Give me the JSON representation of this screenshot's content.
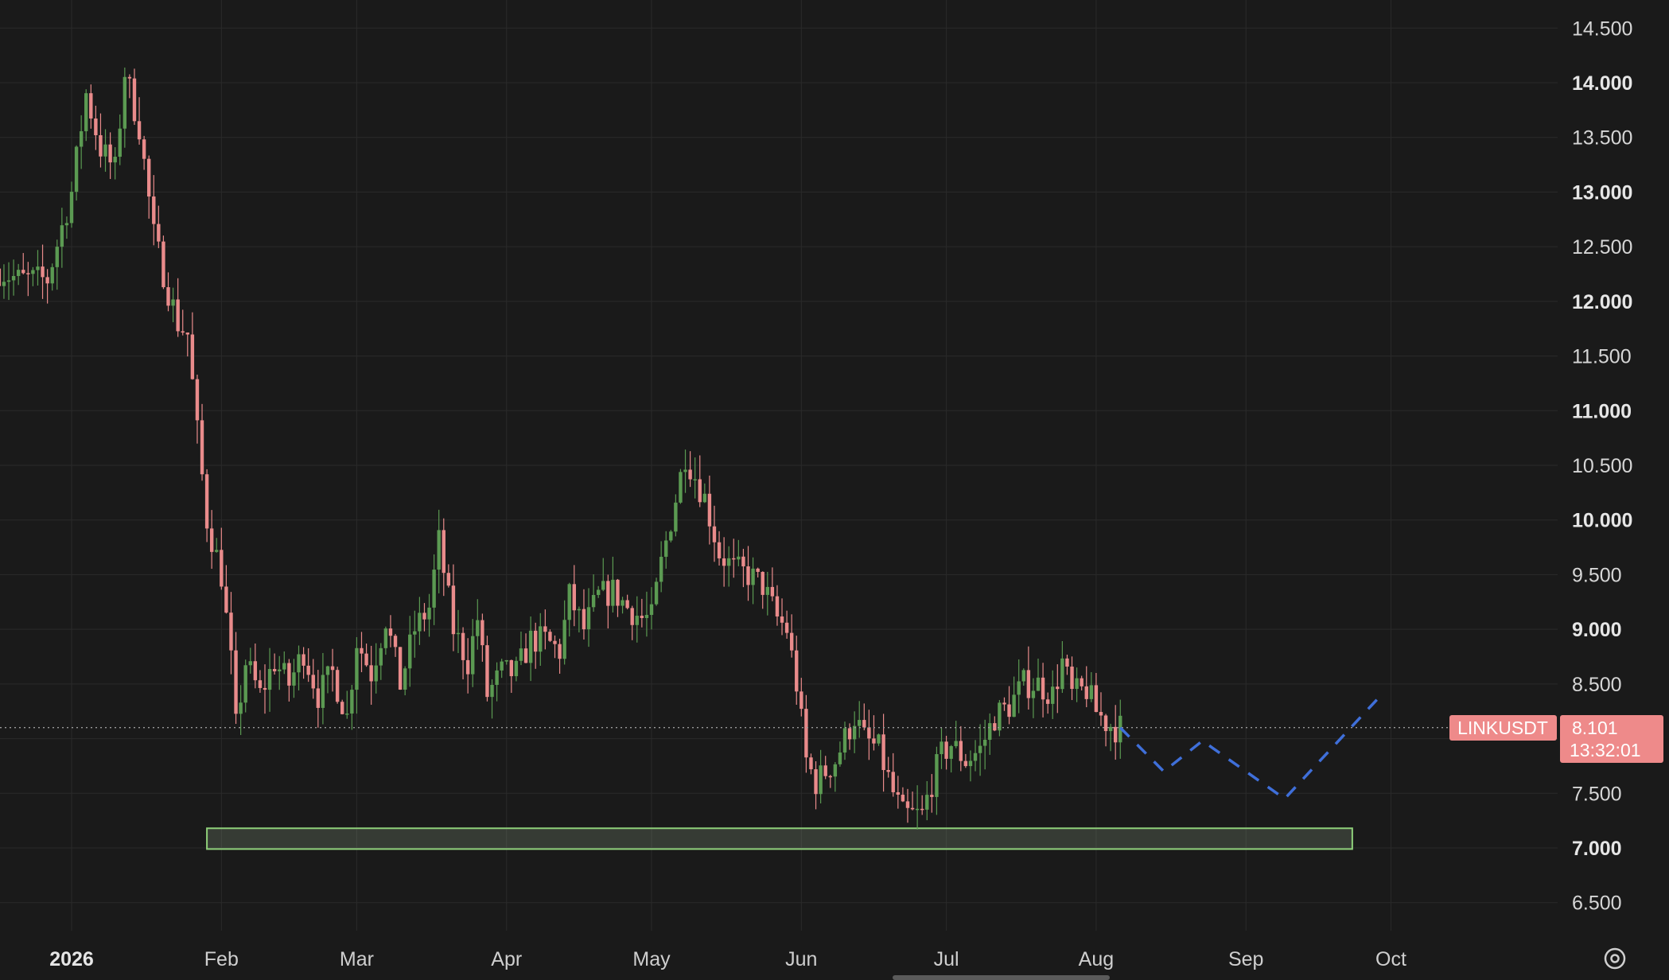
{
  "chart_data": {
    "type": "candlestick",
    "symbol": "LINKUSDT",
    "last_price": "8.101",
    "countdown": "13:32:01",
    "y_ticks": [
      {
        "value": 14.5,
        "label": "14.500",
        "major": false
      },
      {
        "value": 14.0,
        "label": "14.000",
        "major": true
      },
      {
        "value": 13.5,
        "label": "13.500",
        "major": false
      },
      {
        "value": 13.0,
        "label": "13.000",
        "major": true
      },
      {
        "value": 12.5,
        "label": "12.500",
        "major": false
      },
      {
        "value": 12.0,
        "label": "12.000",
        "major": true
      },
      {
        "value": 11.5,
        "label": "11.500",
        "major": false
      },
      {
        "value": 11.0,
        "label": "11.000",
        "major": true
      },
      {
        "value": 10.5,
        "label": "10.500",
        "major": false
      },
      {
        "value": 10.0,
        "label": "10.000",
        "major": true
      },
      {
        "value": 9.5,
        "label": "9.500",
        "major": false
      },
      {
        "value": 9.0,
        "label": "9.000",
        "major": true
      },
      {
        "value": 8.5,
        "label": "8.500",
        "major": false
      },
      {
        "value": 7.5,
        "label": "7.500",
        "major": false
      },
      {
        "value": 7.0,
        "label": "7.000",
        "major": true
      },
      {
        "value": 6.5,
        "label": "6.500",
        "major": false
      }
    ],
    "x_ticks": [
      {
        "date": "2026-01-01",
        "label": "2026",
        "major": true
      },
      {
        "date": "2026-02-01",
        "label": "Feb",
        "major": false
      },
      {
        "date": "2026-03-01",
        "label": "Mar",
        "major": false
      },
      {
        "date": "2026-04-01",
        "label": "Apr",
        "major": false
      },
      {
        "date": "2026-05-01",
        "label": "May",
        "major": false
      },
      {
        "date": "2026-06-01",
        "label": "Jun",
        "major": false
      },
      {
        "date": "2026-07-01",
        "label": "Jul",
        "major": false
      },
      {
        "date": "2026-08-01",
        "label": "Aug",
        "major": false
      },
      {
        "date": "2026-09-01",
        "label": "Sep",
        "major": false
      },
      {
        "date": "2026-10-01",
        "label": "Oct",
        "major": false
      }
    ],
    "x_range": [
      "2025-12-17",
      "2026-10-16"
    ],
    "y_range": [
      6.2,
      14.75
    ],
    "price_path_keypoints": [
      [
        "2025-12-17",
        12.3
      ],
      [
        "2025-12-22",
        12.2
      ],
      [
        "2025-12-28",
        12.2
      ],
      [
        "2026-01-02",
        13.0
      ],
      [
        "2026-01-05",
        13.9
      ],
      [
        "2026-01-08",
        13.4
      ],
      [
        "2026-01-11",
        13.2
      ],
      [
        "2026-01-13",
        14.1
      ],
      [
        "2026-01-16",
        13.6
      ],
      [
        "2026-01-19",
        12.6
      ],
      [
        "2026-01-22",
        12.1
      ],
      [
        "2026-01-24",
        11.8
      ],
      [
        "2026-01-26",
        11.7
      ],
      [
        "2026-01-28",
        10.8
      ],
      [
        "2026-01-30",
        10.0
      ],
      [
        "2026-02-02",
        9.5
      ],
      [
        "2026-02-04",
        8.7
      ],
      [
        "2026-02-05",
        8.1
      ],
      [
        "2026-02-07",
        8.7
      ],
      [
        "2026-02-10",
        8.4
      ],
      [
        "2026-02-13",
        8.7
      ],
      [
        "2026-02-16",
        8.5
      ],
      [
        "2026-02-19",
        8.8
      ],
      [
        "2026-02-22",
        8.4
      ],
      [
        "2026-02-25",
        8.6
      ],
      [
        "2026-02-28",
        8.2
      ],
      [
        "2026-03-02",
        8.9
      ],
      [
        "2026-03-05",
        8.6
      ],
      [
        "2026-03-08",
        9.1
      ],
      [
        "2026-03-11",
        8.5
      ],
      [
        "2026-03-14",
        9.0
      ],
      [
        "2026-03-17",
        9.2
      ],
      [
        "2026-03-19",
        9.8
      ],
      [
        "2026-03-22",
        9.0
      ],
      [
        "2026-03-25",
        8.7
      ],
      [
        "2026-03-27",
        9.1
      ],
      [
        "2026-03-29",
        8.4
      ],
      [
        "2026-04-01",
        8.6
      ],
      [
        "2026-04-04",
        8.6
      ],
      [
        "2026-04-07",
        8.9
      ],
      [
        "2026-04-10",
        8.9
      ],
      [
        "2026-04-13",
        8.8
      ],
      [
        "2026-04-15",
        9.3
      ],
      [
        "2026-04-18",
        9.0
      ],
      [
        "2026-04-21",
        9.3
      ],
      [
        "2026-04-24",
        9.35
      ],
      [
        "2026-04-27",
        9.2
      ],
      [
        "2026-04-30",
        9.1
      ],
      [
        "2026-05-02",
        9.1
      ],
      [
        "2026-05-04",
        9.6
      ],
      [
        "2026-05-06",
        10.0
      ],
      [
        "2026-05-09",
        10.6
      ],
      [
        "2026-05-11",
        10.4
      ],
      [
        "2026-05-13",
        10.2
      ],
      [
        "2026-05-16",
        9.7
      ],
      [
        "2026-05-19",
        9.55
      ],
      [
        "2026-05-22",
        9.5
      ],
      [
        "2026-05-25",
        9.4
      ],
      [
        "2026-05-28",
        9.1
      ],
      [
        "2026-05-30",
        9.0
      ],
      [
        "2026-06-01",
        8.5
      ],
      [
        "2026-06-03",
        7.8
      ],
      [
        "2026-06-05",
        7.6
      ],
      [
        "2026-06-07",
        7.7
      ],
      [
        "2026-06-09",
        7.8
      ],
      [
        "2026-06-11",
        8.0
      ],
      [
        "2026-06-13",
        8.2
      ],
      [
        "2026-06-15",
        8.0
      ],
      [
        "2026-06-18",
        7.9
      ],
      [
        "2026-06-21",
        7.5
      ],
      [
        "2026-06-23",
        7.3
      ],
      [
        "2026-06-25",
        7.3
      ],
      [
        "2026-06-27",
        7.3
      ],
      [
        "2026-06-29",
        7.6
      ],
      [
        "2026-07-01",
        7.85
      ],
      [
        "2026-07-03",
        7.95
      ],
      [
        "2026-07-06",
        7.8
      ],
      [
        "2026-07-09",
        7.9
      ],
      [
        "2026-07-12",
        8.2
      ],
      [
        "2026-07-15",
        8.3
      ],
      [
        "2026-07-18",
        8.5
      ],
      [
        "2026-07-21",
        8.5
      ],
      [
        "2026-07-24",
        8.4
      ],
      [
        "2026-07-26",
        8.7
      ],
      [
        "2026-07-28",
        8.4
      ],
      [
        "2026-07-31",
        8.45
      ],
      [
        "2026-08-02",
        8.25
      ],
      [
        "2026-08-04",
        8.15
      ],
      [
        "2026-08-06",
        8.1
      ]
    ],
    "forecast_path": [
      [
        "2026-08-06",
        8.1
      ],
      [
        "2026-08-15",
        7.7
      ],
      [
        "2026-08-23",
        7.98
      ],
      [
        "2026-09-09",
        7.45
      ],
      [
        "2026-09-29",
        8.4
      ]
    ],
    "support_zone": {
      "from": "2026-01-29",
      "to": "2026-09-23",
      "low": 6.99,
      "high": 7.18
    },
    "colors": {
      "background": "#1a1a1a",
      "grid": "#2a2a2a",
      "up": "#5b9a52",
      "down": "#e98b8b",
      "forecast": "#3f6fd9",
      "zone_stroke": "#8fd07a",
      "zone_fill": "rgba(140,160,130,0.25)",
      "price_tag": "#ee8a8a",
      "price_line": "#9a9a9a"
    },
    "grid": true,
    "settings_icon": "settings-gear-icon"
  }
}
